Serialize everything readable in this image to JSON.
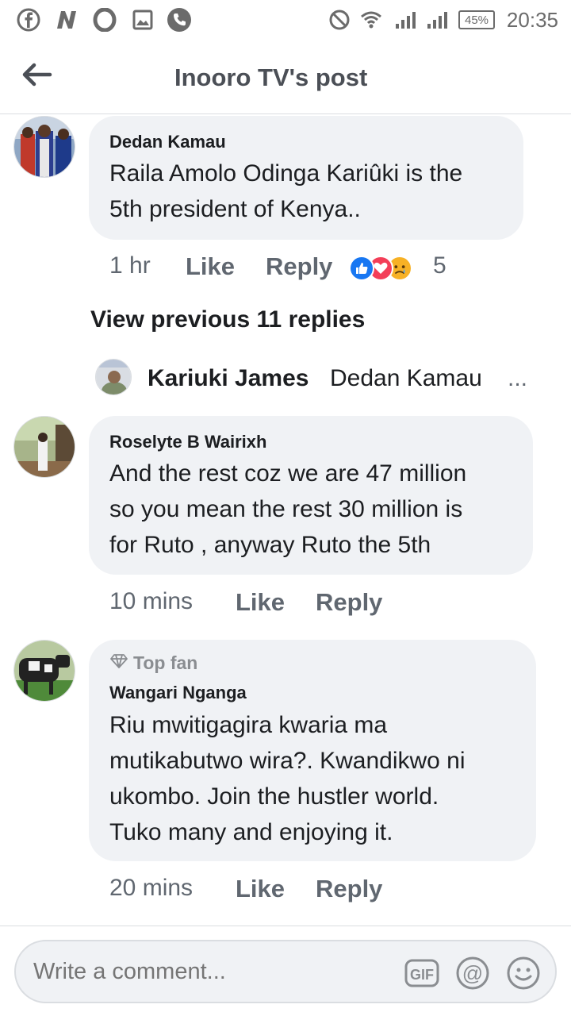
{
  "status_bar": {
    "time": "20:35",
    "battery": "45%",
    "left_icons": [
      "facebook-icon",
      "n-app-icon",
      "opera-icon",
      "gallery-icon",
      "phone-icon"
    ],
    "right_icons": [
      "dnd-icon",
      "wifi-icon",
      "signal-icon",
      "signal-icon"
    ]
  },
  "header": {
    "title": "Inooro TV's post",
    "back_icon": "back-arrow-icon"
  },
  "comments": [
    {
      "author": "Dedan Kamau",
      "text": "Raila Amolo Odinga Kariûki is the\n5th president of Kenya..",
      "time": "1 hr",
      "like": "Like",
      "reply": "Reply",
      "reaction_count": "5",
      "reactions": [
        "like-reaction-icon",
        "love-reaction-icon",
        "sad-reaction-icon"
      ]
    },
    {
      "author": "Roselyte B Wairixh",
      "text": "And the rest coz we are 47 million\nso you mean the rest 30 million is\nfor Ruto , anyway Ruto the 5th",
      "time": "10 mins",
      "like": "Like",
      "reply": "Reply"
    },
    {
      "badge": "Top fan",
      "author": "Wangari Nganga",
      "text": "Riu mwitigagira kwaria ma\nmutikabutwo wira?. Kwandikwo ni\nukombo. Join the hustler world.\nTuko many and enjoying it.",
      "time": "20 mins",
      "like": "Like",
      "reply": "Reply"
    }
  ],
  "view_previous": "View previous 11 replies",
  "reply_preview": {
    "author": "Kariuki James",
    "snippet": "Dedan Kamau",
    "more": "..."
  },
  "composer": {
    "placeholder": "Write a comment...",
    "icons": [
      "gif-icon",
      "mention-icon",
      "emoji-icon"
    ],
    "gif_label": "GIF"
  },
  "colors": {
    "bubble": "#f0f2f5",
    "like_blue": "#1877f2",
    "love_red": "#f33e58",
    "sad_yellow": "#f7b125",
    "meta_grey": "#606770"
  }
}
